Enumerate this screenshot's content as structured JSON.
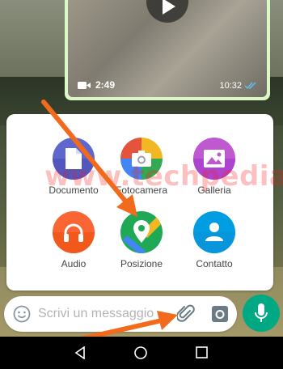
{
  "video": {
    "duration": "2:49",
    "time": "10:32",
    "icon": "video-camera-icon"
  },
  "attachments": [
    {
      "label": "Documento",
      "icon": "document-icon",
      "color": "#5f66cd"
    },
    {
      "label": "Fotocamera",
      "icon": "camera-icon",
      "color": "#e5533c"
    },
    {
      "label": "Galleria",
      "icon": "gallery-icon",
      "color": "#bf59cf"
    },
    {
      "label": "Audio",
      "icon": "headphones-icon",
      "color": "#f96533"
    },
    {
      "label": "Posizione",
      "icon": "location-pin-icon",
      "color": "#1fa855"
    },
    {
      "label": "Contatto",
      "icon": "contact-icon",
      "color": "#009de2"
    }
  ],
  "watermark": "www.techpedia.it",
  "input": {
    "placeholder": "Scrivi un messaggio"
  },
  "colors": {
    "accent": "#00a884",
    "arrow": "#f26b1d"
  }
}
